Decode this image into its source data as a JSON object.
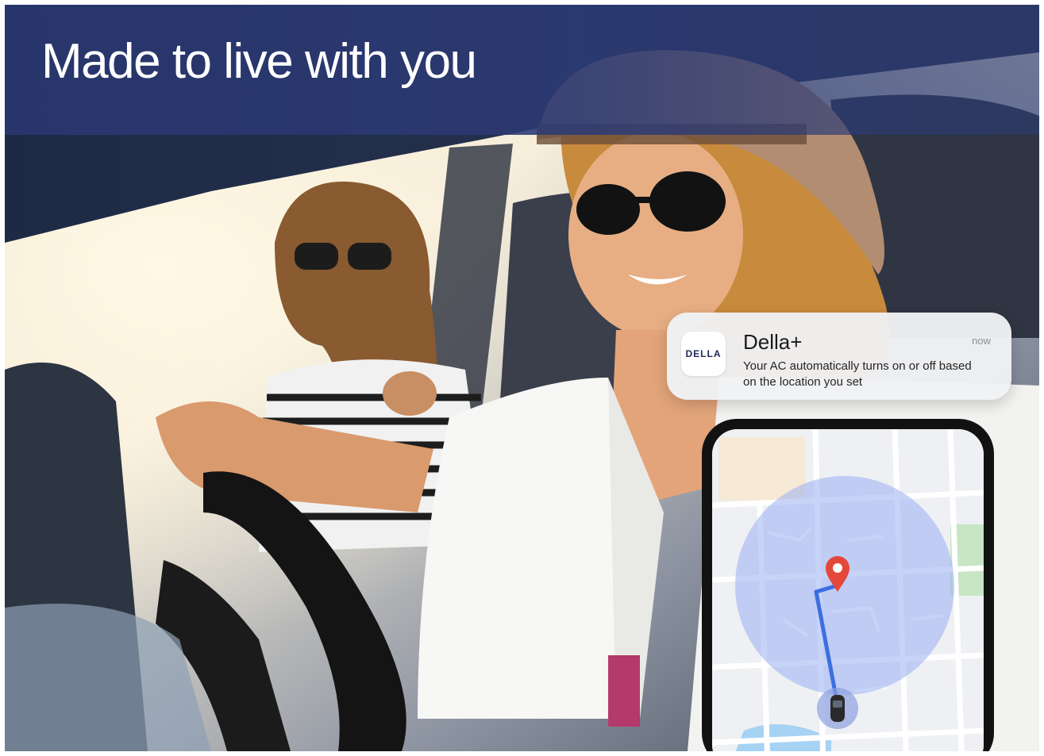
{
  "hero": {
    "headline": "Made to live with you"
  },
  "notification": {
    "app_logo_text": "DELLA",
    "app_name": "Della+",
    "time": "now",
    "message": "Your AC automatically turns on or off based on the location you set"
  },
  "map": {
    "icons": [
      "location-pin-icon",
      "car-icon"
    ],
    "colors": {
      "radius": "#9aaef2",
      "route": "#3b6fe0",
      "pin": "#e5483a",
      "water": "#a6d2f3",
      "park": "#c7e6c4"
    }
  }
}
